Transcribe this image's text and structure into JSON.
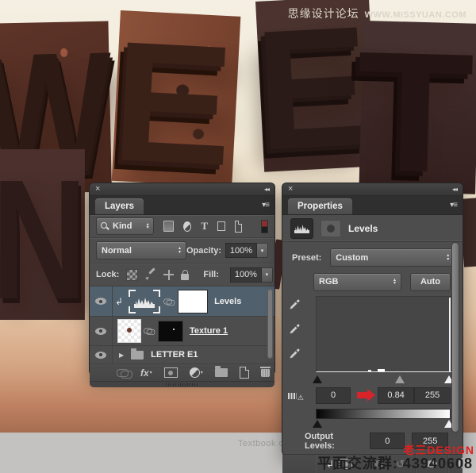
{
  "watermark": {
    "site": "思缘设计论坛",
    "url": "WWW.MISSYUAN.COM"
  },
  "letters": {
    "l1": "W",
    "l2": "E",
    "l3": "E",
    "l4": "T",
    "l5": "N"
  },
  "layers_panel": {
    "tab": "Layers",
    "filter_kind": "Kind",
    "blend_mode": "Normal",
    "opacity_label": "Opacity:",
    "opacity": "100%",
    "lock_label": "Lock:",
    "fill_label": "Fill:",
    "fill": "100%",
    "fx_label": "fx",
    "layers": [
      {
        "name": "Levels"
      },
      {
        "name": "Texture 1"
      },
      {
        "name": "LETTER E1"
      }
    ]
  },
  "properties_panel": {
    "tab": "Properties",
    "title": "Levels",
    "preset_label": "Preset:",
    "preset": "Custom",
    "channel": "RGB",
    "auto_label": "Auto",
    "input_shadow": "0",
    "input_midtone": "0.84",
    "input_highlight": "255",
    "output_label": "Output Levels:",
    "output_low": "0",
    "output_high": "255"
  },
  "footer": {
    "watermark_text": "Textbook of translation",
    "designer": "老三DESIGN",
    "group_text": "平面交流群: 43940608"
  },
  "colors": {
    "selected_layer": "#50606e",
    "annotation_red": "#d8232a",
    "panel_bg": "#4d4d4d"
  }
}
